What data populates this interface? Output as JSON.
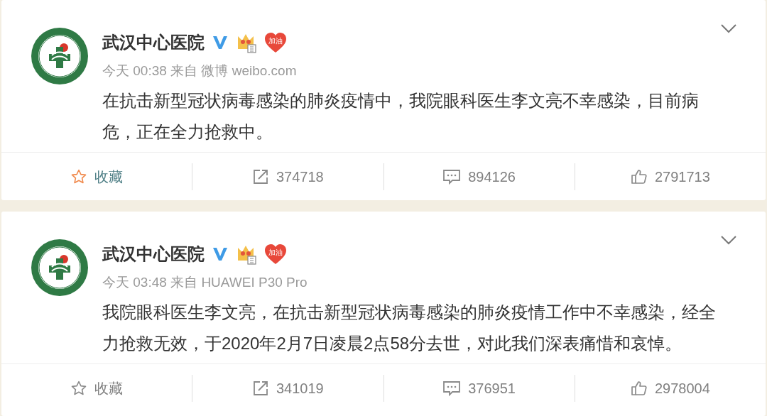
{
  "posts": [
    {
      "author": "武汉中心医院",
      "verified": true,
      "badge": "加油",
      "meta": "今天 00:38 来自 微博 weibo.com",
      "text": "在抗击新型冠状病毒感染的肺炎疫情中，我院眼科医生李文亮不幸感染，目前病危，正在全力抢救中。",
      "actions": [
        {
          "kind": "favorite",
          "label": "收藏",
          "selected": true
        },
        {
          "kind": "repost",
          "label": "374718"
        },
        {
          "kind": "comment",
          "label": "894126"
        },
        {
          "kind": "like",
          "label": "2791713"
        }
      ]
    },
    {
      "author": "武汉中心医院",
      "verified": true,
      "badge": "加油",
      "meta": "今天 03:48 来自 HUAWEI P30 Pro",
      "text": "我院眼科医生李文亮，在抗击新型冠状病毒感染的肺炎疫情工作中不幸感染，经全力抢救无效，于2020年2月7日凌晨2点58分去世，对此我们深表痛惜和哀悼。",
      "actions": [
        {
          "kind": "favorite",
          "label": "收藏",
          "selected": false
        },
        {
          "kind": "repost",
          "label": "341019"
        },
        {
          "kind": "comment",
          "label": "376951"
        },
        {
          "kind": "like",
          "label": "2978004"
        }
      ]
    }
  ]
}
